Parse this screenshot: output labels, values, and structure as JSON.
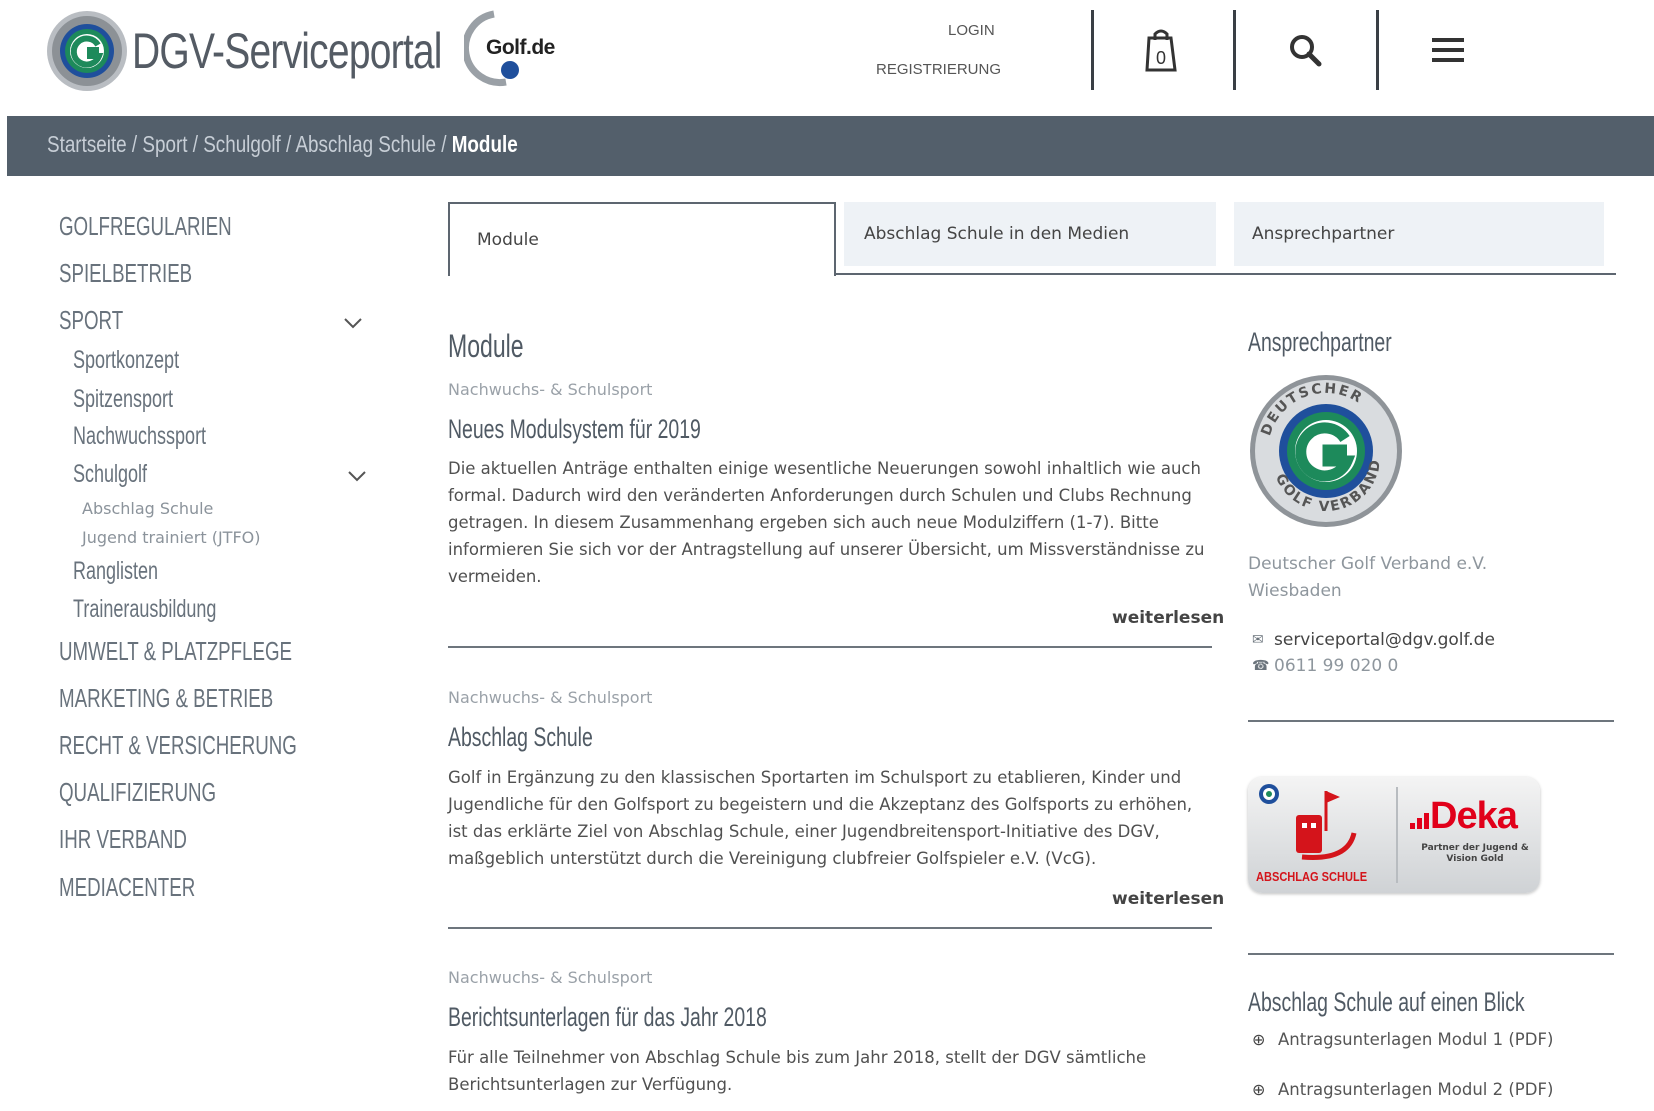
{
  "header": {
    "site_title": "DGV-Serviceportal",
    "partner_logo_text": "Golf.de",
    "login": "LOGIN",
    "register": "REGISTRIERUNG",
    "cart_count": "0"
  },
  "breadcrumb": {
    "items": [
      "Startseite",
      "Sport",
      "Schulgolf",
      "Abschlag Schule"
    ],
    "separator": " / ",
    "current": "Module"
  },
  "sidebar": {
    "items": [
      {
        "label": "GOLFREGULARIEN"
      },
      {
        "label": "SPIELBETRIEB"
      },
      {
        "label": "SPORT",
        "expanded": true
      },
      {
        "label": "Sportkonzept"
      },
      {
        "label": "Spitzensport"
      },
      {
        "label": "Nachwuchssport"
      },
      {
        "label": "Schulgolf",
        "expanded": true
      },
      {
        "label": "Abschlag Schule"
      },
      {
        "label": "Jugend trainiert (JTFO)"
      },
      {
        "label": "Ranglisten"
      },
      {
        "label": "Trainerausbildung"
      },
      {
        "label": "UMWELT & PLATZPFLEGE"
      },
      {
        "label": "MARKETING & BETRIEB"
      },
      {
        "label": "RECHT & VERSICHERUNG"
      },
      {
        "label": "QUALIFIZIERUNG"
      },
      {
        "label": "IHR VERBAND"
      },
      {
        "label": "MEDIACENTER"
      }
    ]
  },
  "tabs": [
    {
      "label": "Module",
      "active": true
    },
    {
      "label": "Abschlag Schule in den Medien"
    },
    {
      "label": "Ansprechpartner"
    }
  ],
  "main": {
    "heading": "Module",
    "articles": [
      {
        "category": "Nachwuchs- & Schulsport",
        "title": "Neues Modulsystem für 2019",
        "body": "Die aktuellen Anträge enthalten einige wesentliche Neuerungen sowohl inhaltlich wie auch formal. Dadurch wird den veränderten Anforderungen durch Schulen und Clubs Rechnung getragen. In diesem Zusammenhang ergeben sich auch neue Modulziffern (1-7). Bitte informieren Sie sich vor der Antragstellung auf unserer Übersicht, um Missverständnisse zu vermeiden.",
        "more": "weiterlesen"
      },
      {
        "category": "Nachwuchs- & Schulsport",
        "title": "Abschlag Schule",
        "body": "Golf in Ergänzung zu den klassischen Sportarten im Schulsport zu etablieren, Kinder und Jugendliche für den Golfsport zu begeistern und die Akzeptanz des Golfsports zu erhöhen, ist das erklärte Ziel von Abschlag Schule, einer Jugendbreitensport-Initiative des DGV, maßgeblich unterstützt durch die Vereinigung clubfreier Golfspieler e.V. (VcG).",
        "more": "weiterlesen"
      },
      {
        "category": "Nachwuchs- & Schulsport",
        "title": "Berichtsunterlagen für das Jahr 2018",
        "body": "Für alle Teilnehmer von Abschlag Schule bis zum Jahr 2018, stellt der DGV sämtliche Berichtsunterlagen zur Verfügung."
      }
    ]
  },
  "aside": {
    "contact_heading": "Ansprechpartner",
    "org_name": "Deutscher Golf Verband e.V.",
    "city": "Wiesbaden",
    "email": "serviceportal@dgv.golf.de",
    "phone": "0611 99 020 0",
    "banner_left_text": "ABSCHLAG SCHULE",
    "banner_brand": "Deka",
    "banner_tagline": "Partner der Jugend & Vision Gold",
    "overview_heading": "Abschlag Schule auf einen Blick",
    "downloads": [
      {
        "label": "Antragsunterlagen Modul 1 (PDF)"
      },
      {
        "label": "Antragsunterlagen Modul 2 (PDF)"
      }
    ]
  },
  "colors": {
    "breadcrumb_bg": "#535f6b",
    "tab_inactive_bg": "#eef2f6",
    "text_grey": "#68727c",
    "brand_green": "#1d8a5b",
    "brand_blue": "#1f4f9c",
    "deka_red": "#e1001a"
  },
  "icons": {
    "cart": "cart-icon",
    "search": "search-icon",
    "menu": "menu-icon",
    "email": "envelope-icon",
    "phone": "phone-icon",
    "download": "download-icon",
    "chevron": "chevron-down-icon"
  }
}
